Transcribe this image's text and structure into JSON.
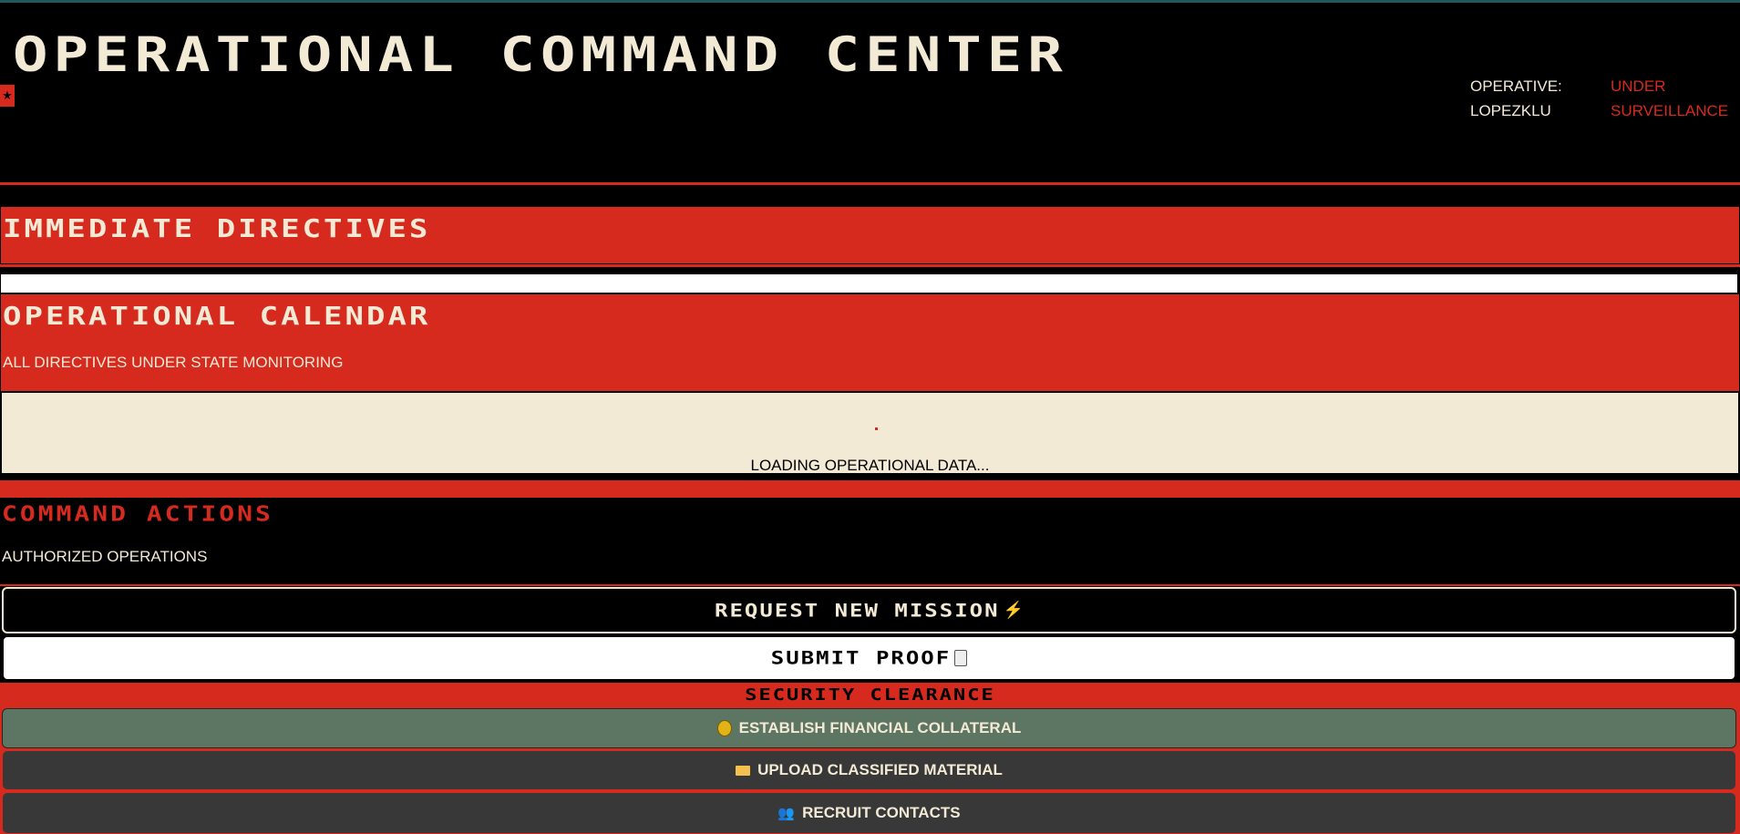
{
  "header": {
    "title": "OPERATIONAL COMMAND CENTER",
    "star_icon": "star-icon",
    "operative_label": "OPERATIVE:",
    "operative_name": "LOPEZKLU",
    "status_line1": "UNDER",
    "status_line2": "SURVEILLANCE"
  },
  "sections": {
    "directives_title": "IMMEDIATE DIRECTIVES",
    "calendar_title": "OPERATIONAL CALENDAR",
    "calendar_subtitle": "ALL DIRECTIVES UNDER STATE MONITORING",
    "loading_text": "LOADING OPERATIONAL DATA..."
  },
  "actions": {
    "title": "COMMAND ACTIONS",
    "subtitle": "AUTHORIZED OPERATIONS",
    "request_mission_label": "REQUEST NEW MISSION",
    "request_mission_icon": "lightning-icon",
    "submit_proof_label": "SUBMIT PROOF",
    "submit_proof_icon": "clipboard-icon"
  },
  "security": {
    "title": "SECURITY CLEARANCE",
    "items": [
      {
        "label": "ESTABLISH FINANCIAL COLLATERAL",
        "icon": "money-bag-icon"
      },
      {
        "label": "UPLOAD CLASSIFIED MATERIAL",
        "icon": "folder-icon"
      },
      {
        "label": "RECRUIT CONTACTS",
        "icon": "people-icon"
      }
    ]
  },
  "colors": {
    "accent_red": "#d62a1e",
    "cream": "#f3ead6",
    "background": "#000000",
    "collateral_green": "#5c7663",
    "dark_button": "#383838"
  }
}
